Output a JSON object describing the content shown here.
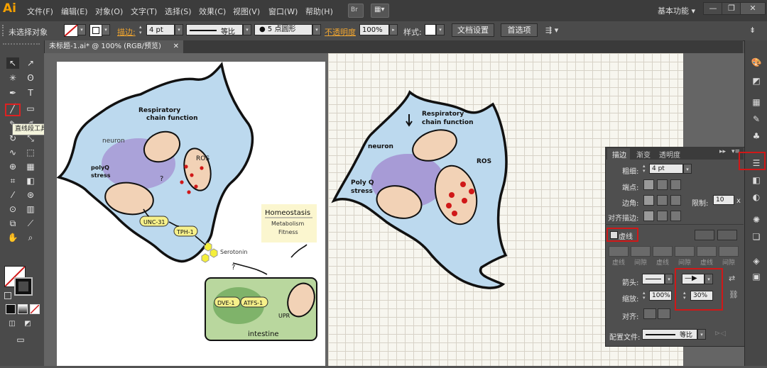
{
  "app": {
    "logo": "Ai",
    "workspace": "基本功能"
  },
  "menu": [
    "文件(F)",
    "编辑(E)",
    "对象(O)",
    "文字(T)",
    "选择(S)",
    "效果(C)",
    "视图(V)",
    "窗口(W)",
    "帮助(H)"
  ],
  "window_buttons": [
    "—",
    "❐",
    "✕"
  ],
  "control_bar": {
    "selection": "未选择对象",
    "stroke_label": "描边:",
    "stroke_weight": "4 pt",
    "profile": "等比",
    "brush": "5 点圆形",
    "opacity_label": "不透明度",
    "opacity": "100%",
    "style_label": "样式:",
    "doc_setup": "文档设置",
    "preferences": "首选项"
  },
  "document_tab": "未标题-1.ai* @ 100% (RGB/预览)",
  "tooltip": "直线段工具 (\\)",
  "figure_left": {
    "respiratory": "Respiratory",
    "chain_function": "chain function",
    "neuron": "neuron",
    "polyq": "polyQ",
    "stress": "stress",
    "ros": "ROS",
    "q1": "?",
    "q2": "?",
    "unc31": "UNC-31",
    "tph1": "TPH-1",
    "serotonin": "Serotonin",
    "homeostasis": "Homeostasis",
    "metabolism": "Metabolism",
    "fitness": "Fitness",
    "dve1": "DVE-1",
    "atfs1": "ATFS-1",
    "upr": "UPR",
    "upr_sup": "mt",
    "intestine": "intestine"
  },
  "figure_right": {
    "respiratory": "Respiratory",
    "chain_function": "chain function",
    "neuron": "neuron",
    "ros": "ROS",
    "polyq": "Poly Q",
    "stress": "stress"
  },
  "stroke_panel": {
    "tabs": [
      "描边",
      "渐变",
      "透明度"
    ],
    "weight_label": "粗细:",
    "weight": "4 pt",
    "cap_label": "端点:",
    "corner_label": "边角:",
    "limit_label": "限制:",
    "limit": "10",
    "limit_unit": "x",
    "align_label": "对齐描边:",
    "dashed_label": "虚线",
    "dash_labels": [
      "虚线",
      "间隙",
      "虚线",
      "间隙",
      "虚线",
      "间隙"
    ],
    "arrow_label": "箭头:",
    "scale_label": "缩放:",
    "scale_start": "100%",
    "scale_end": "30%",
    "align2_label": "对齐:",
    "profile_label": "配置文件:",
    "profile": "等比"
  },
  "colors": {
    "accent_red": "#d01818",
    "link_orange": "#f0a530",
    "cell_blue": "#bcd9ee",
    "nucleus_purple": "#a79bd6"
  }
}
